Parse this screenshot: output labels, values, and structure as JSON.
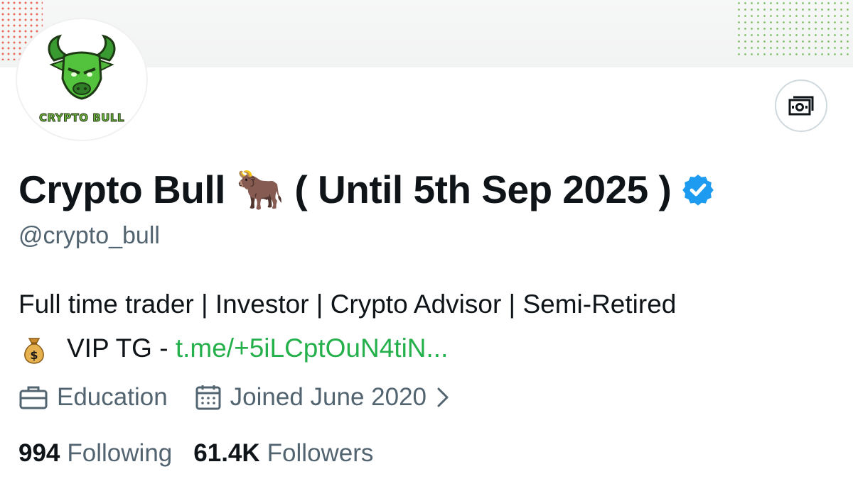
{
  "profile": {
    "display_name": "Crypto Bull 🐂 ( Until 5th Sep 2025 )",
    "handle": "@crypto_bull",
    "verified": true,
    "avatar_logo_text": "CRYPTO BULL",
    "bio": {
      "line1": "Full time trader | Investor | Crypto Advisor | Semi-Retired",
      "line2_prefix": "VIP TG - ",
      "line2_link": "t.me/+5iLCptOuN4tiN..."
    },
    "meta": {
      "category": "Education",
      "joined": "Joined June 2020"
    },
    "stats": {
      "following_count": "994",
      "following_label": "Following",
      "followers_count": "61.4K",
      "followers_label": "Followers"
    }
  },
  "icons": {
    "action_button": "money-icon",
    "verified": "verified-badge-icon",
    "bio_emoji": "money-bag-icon",
    "category": "briefcase-icon",
    "joined": "calendar-icon",
    "joined_more": "chevron-right-icon"
  },
  "colors": {
    "text_primary": "#0f1419",
    "text_secondary": "#536471",
    "link": "#24b04a",
    "verified": "#1d9bf0",
    "logo_green": "#6cbf3a"
  }
}
